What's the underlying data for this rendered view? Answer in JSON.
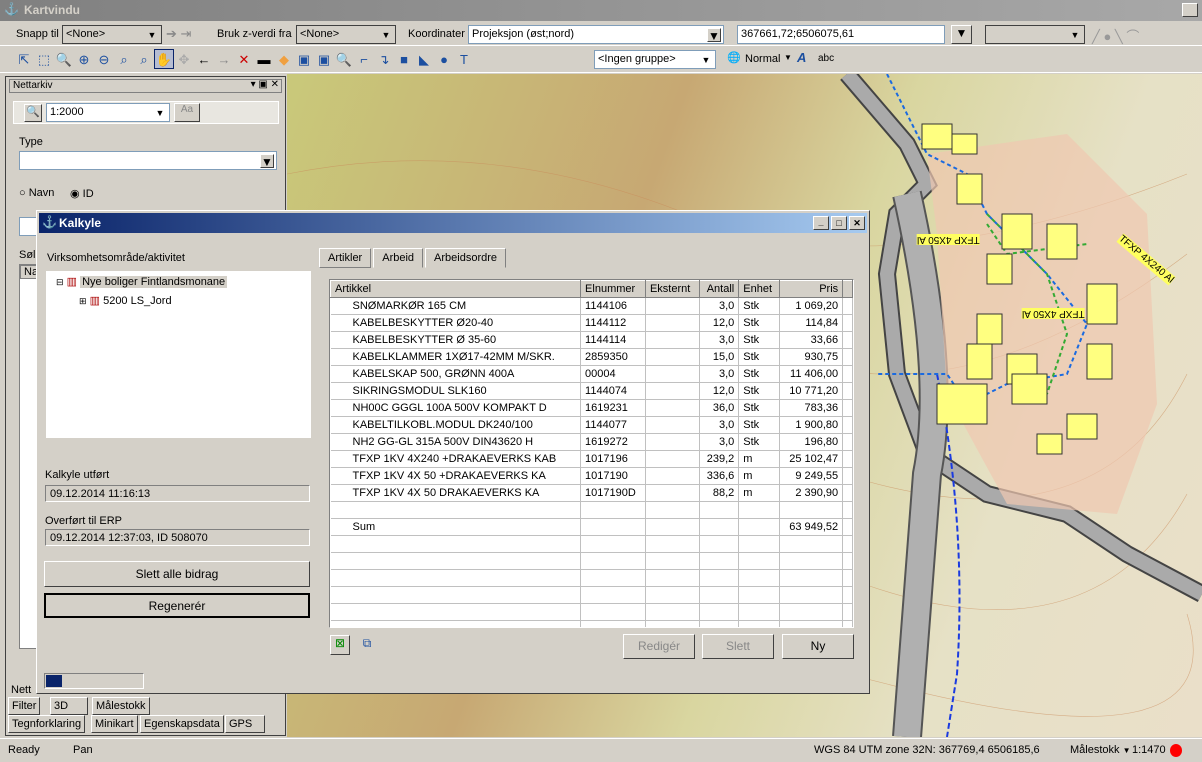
{
  "window": {
    "title": "Kartvindu"
  },
  "toolbar1": {
    "snap_label": "Snapp til",
    "snap_value": "<None>",
    "z_label": "Bruk z-verdi fra",
    "z_value": "<None>",
    "coord_label": "Koordinater",
    "coord_system": "Projeksjon (øst;nord)",
    "coord_value": "367661,72;6506075,61"
  },
  "toolbar2": {
    "group_value": "<Ingen gruppe>",
    "style_value": "Normal"
  },
  "left_panel": {
    "title": "Nettarkiv",
    "scale": "1:2000",
    "type_label": "Type",
    "radio_name": "Navn",
    "radio_id": "ID",
    "search_label": "Søl",
    "list_header": "Na",
    "bottom_label": "Nett",
    "tabs_row1": [
      "Filter",
      "3D",
      "Målestokk"
    ],
    "tabs_row2": [
      "Tegnforklaring",
      "Minikart",
      "Egenskapsdata",
      "GPS"
    ]
  },
  "dialog": {
    "title": "Kalkyle",
    "tree_label": "Virksomhetsområde/aktivitet",
    "tree": [
      {
        "label": "Nye boliger Fintlandsmonane"
      },
      {
        "label": "5200 LS_Jord"
      }
    ],
    "kalkyle_label": "Kalkyle utført",
    "kalkyle_value": "09.12.2014 11:16:13",
    "erp_label": "Overført til ERP",
    "erp_value": "09.12.2014 12:37:03, ID 508070",
    "delete_all": "Slett alle bidrag",
    "regenerate": "Regenerér",
    "tabs": [
      "Artikler",
      "Arbeid",
      "Arbeidsordre"
    ],
    "columns": [
      "Artikkel",
      "Elnummer",
      "Eksternt",
      "Antall",
      "Enhet",
      "Pris"
    ],
    "rows": [
      [
        "SNØMARKØR 165 CM",
        "1144106",
        "",
        "3,0",
        "Stk",
        "1 069,20"
      ],
      [
        "KABELBESKYTTER Ø20-40",
        "1144112",
        "",
        "12,0",
        "Stk",
        "114,84"
      ],
      [
        "KABELBESKYTTER Ø 35-60",
        "1144114",
        "",
        "3,0",
        "Stk",
        "33,66"
      ],
      [
        "KABELKLAMMER 1XØ17-42MM M/SKR.",
        "2859350",
        "",
        "15,0",
        "Stk",
        "930,75"
      ],
      [
        "KABELSKAP 500, GRØNN 400A",
        "00004",
        "",
        "3,0",
        "Stk",
        "11 406,00"
      ],
      [
        "SIKRINGSMODUL SLK160",
        "1144074",
        "",
        "12,0",
        "Stk",
        "10 771,20"
      ],
      [
        "NH00C GGGL 100A 500V KOMPAKT D",
        "1619231",
        "",
        "36,0",
        "Stk",
        "783,36"
      ],
      [
        "KABELTILKOBL.MODUL DK240/100",
        "1144077",
        "",
        "3,0",
        "Stk",
        "1 900,80"
      ],
      [
        "NH2 GG-GL 315A 500V DIN43620 H",
        "1619272",
        "",
        "3,0",
        "Stk",
        "196,80"
      ],
      [
        "TFXP 1KV 4X240 +DRAKAEVERKS KAB",
        "1017196",
        "",
        "239,2",
        "m",
        "25 102,47"
      ],
      [
        "TFXP 1KV 4X 50  +DRAKAEVERKS KA",
        "1017190",
        "",
        "336,6",
        "m",
        "9 249,55"
      ],
      [
        "TFXP 1KV 4X 50  DRAKAEVERKS KA",
        "1017190D",
        "",
        "88,2",
        "m",
        "2 390,90"
      ]
    ],
    "sum_label": "Sum",
    "sum_value": "63 949,52",
    "edit": "Redigér",
    "delete": "Slett",
    "new": "Ny"
  },
  "map": {
    "labels": [
      "TFXP 4X50 Al",
      "TFXP 4X50 Al",
      "TFXP 4X240 Al"
    ]
  },
  "status": {
    "state": "Ready",
    "mode": "Pan",
    "coords": "WGS 84 UTM zone 32N: 367769,4  6506185,6",
    "scale_label": "Målestokk",
    "scale": "1:1470",
    "indicator_color": "#ff0000"
  }
}
